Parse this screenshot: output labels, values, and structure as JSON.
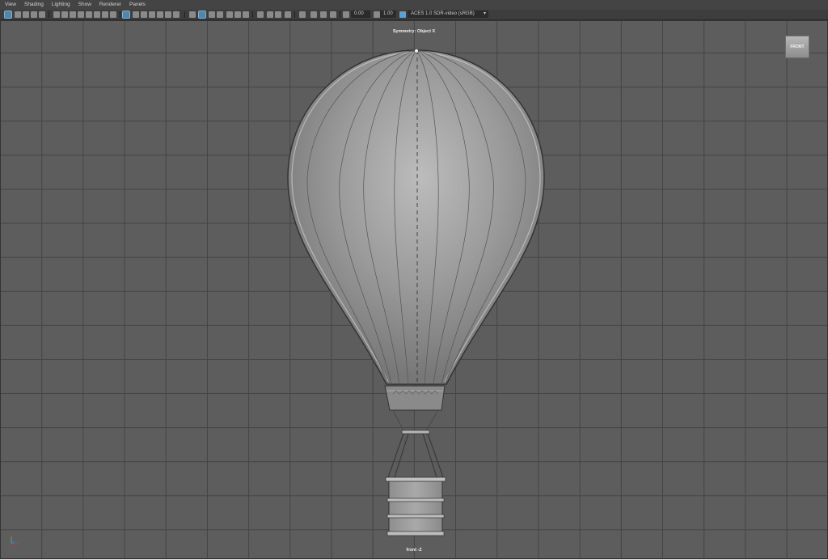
{
  "menu": [
    "View",
    "Shading",
    "Lighting",
    "Show",
    "Renderer",
    "Panels"
  ],
  "toolbar": {
    "field1": "0.00",
    "field2": "1.00",
    "colorspace": "ACES 1.0 SDR-video (sRGB)"
  },
  "viewport": {
    "symmetry": "Symmetry: Object X",
    "camera": "front -Z",
    "viewcube_label": "FRONT"
  },
  "colors": {
    "accent": "#5aa0d0",
    "grid": "#444444",
    "background": "#5d5d5d"
  }
}
